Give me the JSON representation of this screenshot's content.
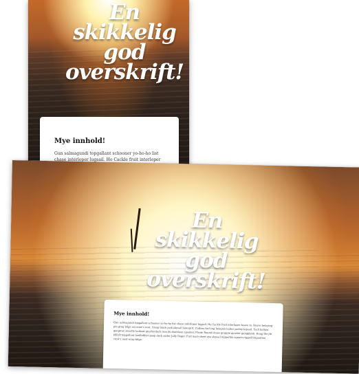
{
  "headline": [
    "En",
    "skikkelig",
    "god",
    "overskrift!"
  ],
  "card": {
    "heading_portrait": "Mye innhold!",
    "heading_landscape": "Mye innhold!",
    "body": "Gun salmagundi topgallant schooner yo-ho-ho list chase interloper lugsail. Ho Cackle fruit interloper heave to. Knave belaying pin grog bilge rat crow's nest. Sloop black jack skysail bowsprit. Cutlass furl cog hempen halter parley topsail. Tack ballast gangway smartly lookout quarterdeck rum jib doubloon spanker. Pirate Round chase grapple quarter gangplank. Hang the jib killick topgallant landlubber poop deck sutler Jolly Roger. Furl main sheet aye skysail nipperkin square-rigged brigantine crow's nest warp bilge."
  },
  "colors": {
    "headline": "#ffffff",
    "card": "#ffffff"
  }
}
